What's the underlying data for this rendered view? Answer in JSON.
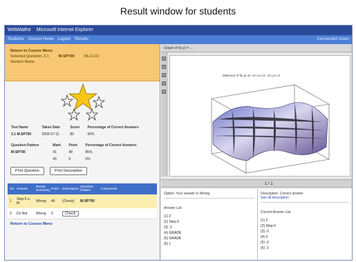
{
  "caption": "Result window for students",
  "window": {
    "app_title": "WebMathe",
    "app_subtitle": "Microsoft Internet Explorer",
    "nav_items": [
      "Students",
      "Course Home",
      "Logout",
      "Results"
    ],
    "nav_right": "Connected Users"
  },
  "left": {
    "return_link": "Return to Course Menu",
    "info_line1": "Selected Question: 3.1",
    "info_line2": "Student Name",
    "code": "M-SP700",
    "date": "06.13.03",
    "test_table": {
      "headers": [
        "Test Name",
        "Taken Date",
        "Score",
        "Percentage of Correct Answers"
      ],
      "row": [
        "3.1  M-SP700",
        "2005-07-11",
        "85",
        "50%"
      ]
    },
    "question_table": {
      "headers": [
        "Question Pattern",
        "Mark",
        "Point",
        "Percentage of Correct Answers"
      ],
      "rows": [
        [
          "M-SP700",
          "41",
          "48",
          "85%"
        ],
        [
          "",
          "40",
          "0",
          "0%"
        ]
      ]
    },
    "buttons": {
      "print_question": "Print Question",
      "print_description": "Print Description"
    },
    "results_table": {
      "headers": [
        "No",
        "Answer",
        "Result Summary",
        "Point",
        "Description",
        "Question Pattern",
        "Comments"
      ],
      "rows": [
        [
          "1",
          "Step 6  u, M",
          "Wrong",
          "46",
          "(Check)",
          "M-SP700",
          ""
        ],
        [
          "2",
          "Do Not",
          "Wrong",
          "0",
          "Check",
          "",
          ""
        ]
      ]
    },
    "bottom_link": "Return to Course Menu"
  },
  "right": {
    "toolbar_text": "Graph of f(x,y) = ...",
    "plot_legend": "Minimum of f(x,y) on -2<=x<=2, -2<=y<=2",
    "page_indicator": "1 / 1",
    "lower_left_header": "Option: Your answer is Wrong.",
    "lower_right_header": "Description: Correct answer",
    "lower_right_link": "See all description",
    "your_answers_title": "Answer List",
    "your_answers": [
      "(1)  2",
      "(2)  Step 6",
      "(3)  -2",
      "(4)  GRADE",
      "(5)  GRADE",
      "(6)  1"
    ],
    "correct_answers_title": "Correct Answer List",
    "correct_answers": [
      "(1)  2",
      "(2)  Step 6",
      "(3)  -2",
      "(4)  2",
      "(5)  -2",
      "(6)  -2"
    ]
  },
  "colors": {
    "title_bar": "#2a4a9a",
    "nav_bar": "#4b7fd6",
    "info_panel": "#f7c774",
    "table_header": "#3f6ec9",
    "highlight_row": "#fbeeb0"
  }
}
